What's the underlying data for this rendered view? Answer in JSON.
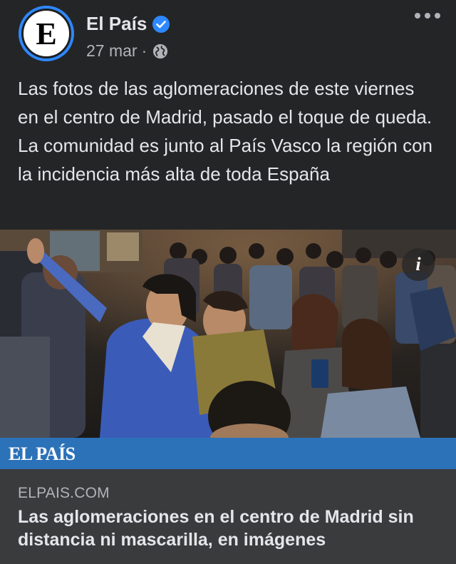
{
  "header": {
    "page_name": "El País",
    "avatar_letter": "E",
    "date": "27 mar",
    "separator": "·",
    "verified_icon": "verified-badge-icon",
    "audience_icon": "globe-icon",
    "more_icon": "more-horizontal-icon"
  },
  "post": {
    "text": "Las fotos de las aglomeraciones de este viernes en el centro de Madrid, pasado el toque de queda. La comunidad es junto al País Vasco la región con la incidencia más alta de toda España"
  },
  "media": {
    "info_label": "i",
    "banner_text": "EL PAÍS"
  },
  "link": {
    "domain": "ELPAIS.COM",
    "title": "Las aglomeraciones en el centro de Madrid sin distancia ni mascarilla, en imágenes"
  },
  "colors": {
    "background": "#242526",
    "link_box": "#3a3b3c",
    "banner": "#2c72b8",
    "accent": "#2d88ff",
    "text_primary": "#e4e6eb",
    "text_secondary": "#b0b3b8"
  }
}
